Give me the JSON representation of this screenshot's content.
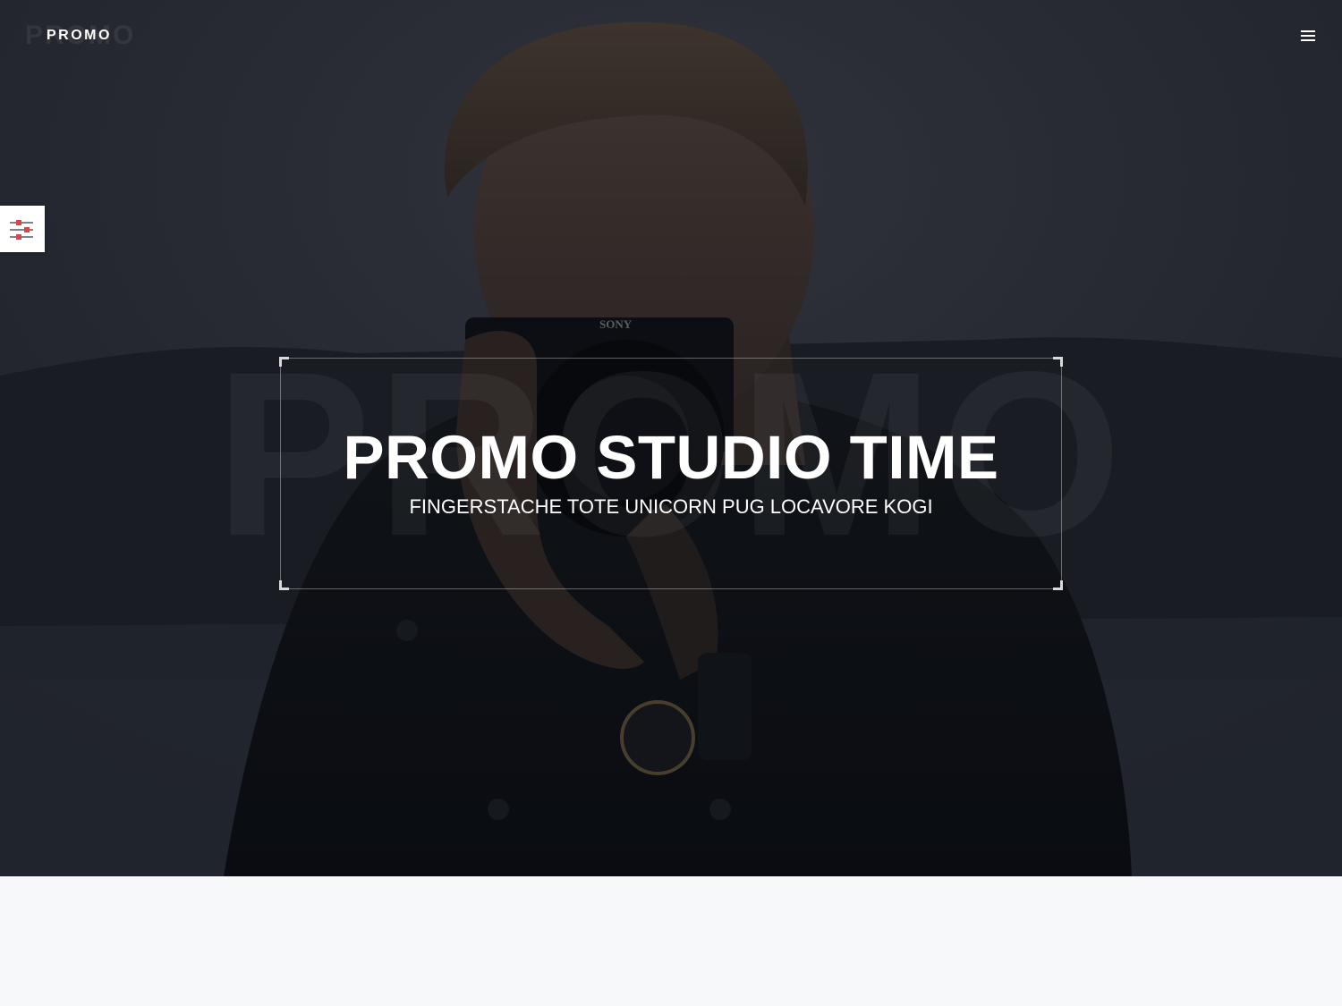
{
  "brand": {
    "name": "PROMO",
    "ghost_text": "PROMO"
  },
  "nav": {
    "menu_icon": "hamburger-icon"
  },
  "settings": {
    "icon": "sliders-icon",
    "accent_color": "#d9464a"
  },
  "hero": {
    "background_text": "PROMO",
    "title": "PROMO STUDIO TIME",
    "subtitle": "FINGERSTACHE TOTE UNICORN PUG LOCAVORE KOGI",
    "camera_brand": "SONY",
    "text_color": "#ffffff"
  },
  "colors": {
    "page_background": "#f7f8fa",
    "hero_dark": "#1d1f27"
  }
}
